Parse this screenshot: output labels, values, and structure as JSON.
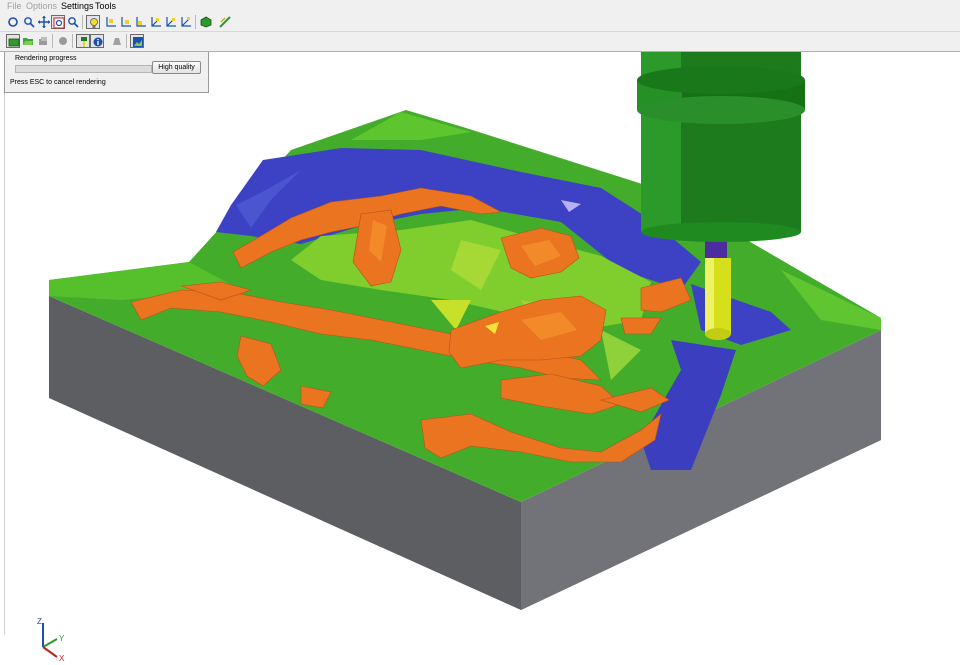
{
  "menu": {
    "file": "File",
    "options": "Options",
    "settings": "Settings",
    "tools": "Tools"
  },
  "toolbar1": {
    "icons": [
      "rotate-view-icon",
      "zoom-icon",
      "pan-icon",
      "zoom-window-icon",
      "zoom-fit-icon",
      "light-bulb-icon",
      "view-xy-icon",
      "view-yz-icon",
      "view-xz-icon",
      "view-iso-1-icon",
      "view-iso-2-icon",
      "view-iso-3-icon",
      "shaded-model-icon",
      "measure-icon"
    ]
  },
  "toolbar2": {
    "icons": [
      "stock-icon",
      "open-folder-icon",
      "parts-icon",
      "fixture-icon",
      "tool-holder-icon",
      "tool-info-icon",
      "machine-icon",
      "render-options-icon"
    ]
  },
  "progress": {
    "title": "Rendering progress",
    "value": 0.0,
    "button_label": "High quality",
    "hint": "Press ESC to cancel rendering"
  },
  "axes": {
    "z": "Z",
    "y": "Y",
    "x": "X"
  },
  "colors": {
    "stock_side": "#5f6064",
    "surface_green": "#3fae2a",
    "deviation_orange": "#e8731e",
    "deviation_blue": "#3b3fc0",
    "tool_holder": "#1d7a1d",
    "tool_shank": "#d8e21a",
    "tool_collar": "#4b2da0"
  }
}
